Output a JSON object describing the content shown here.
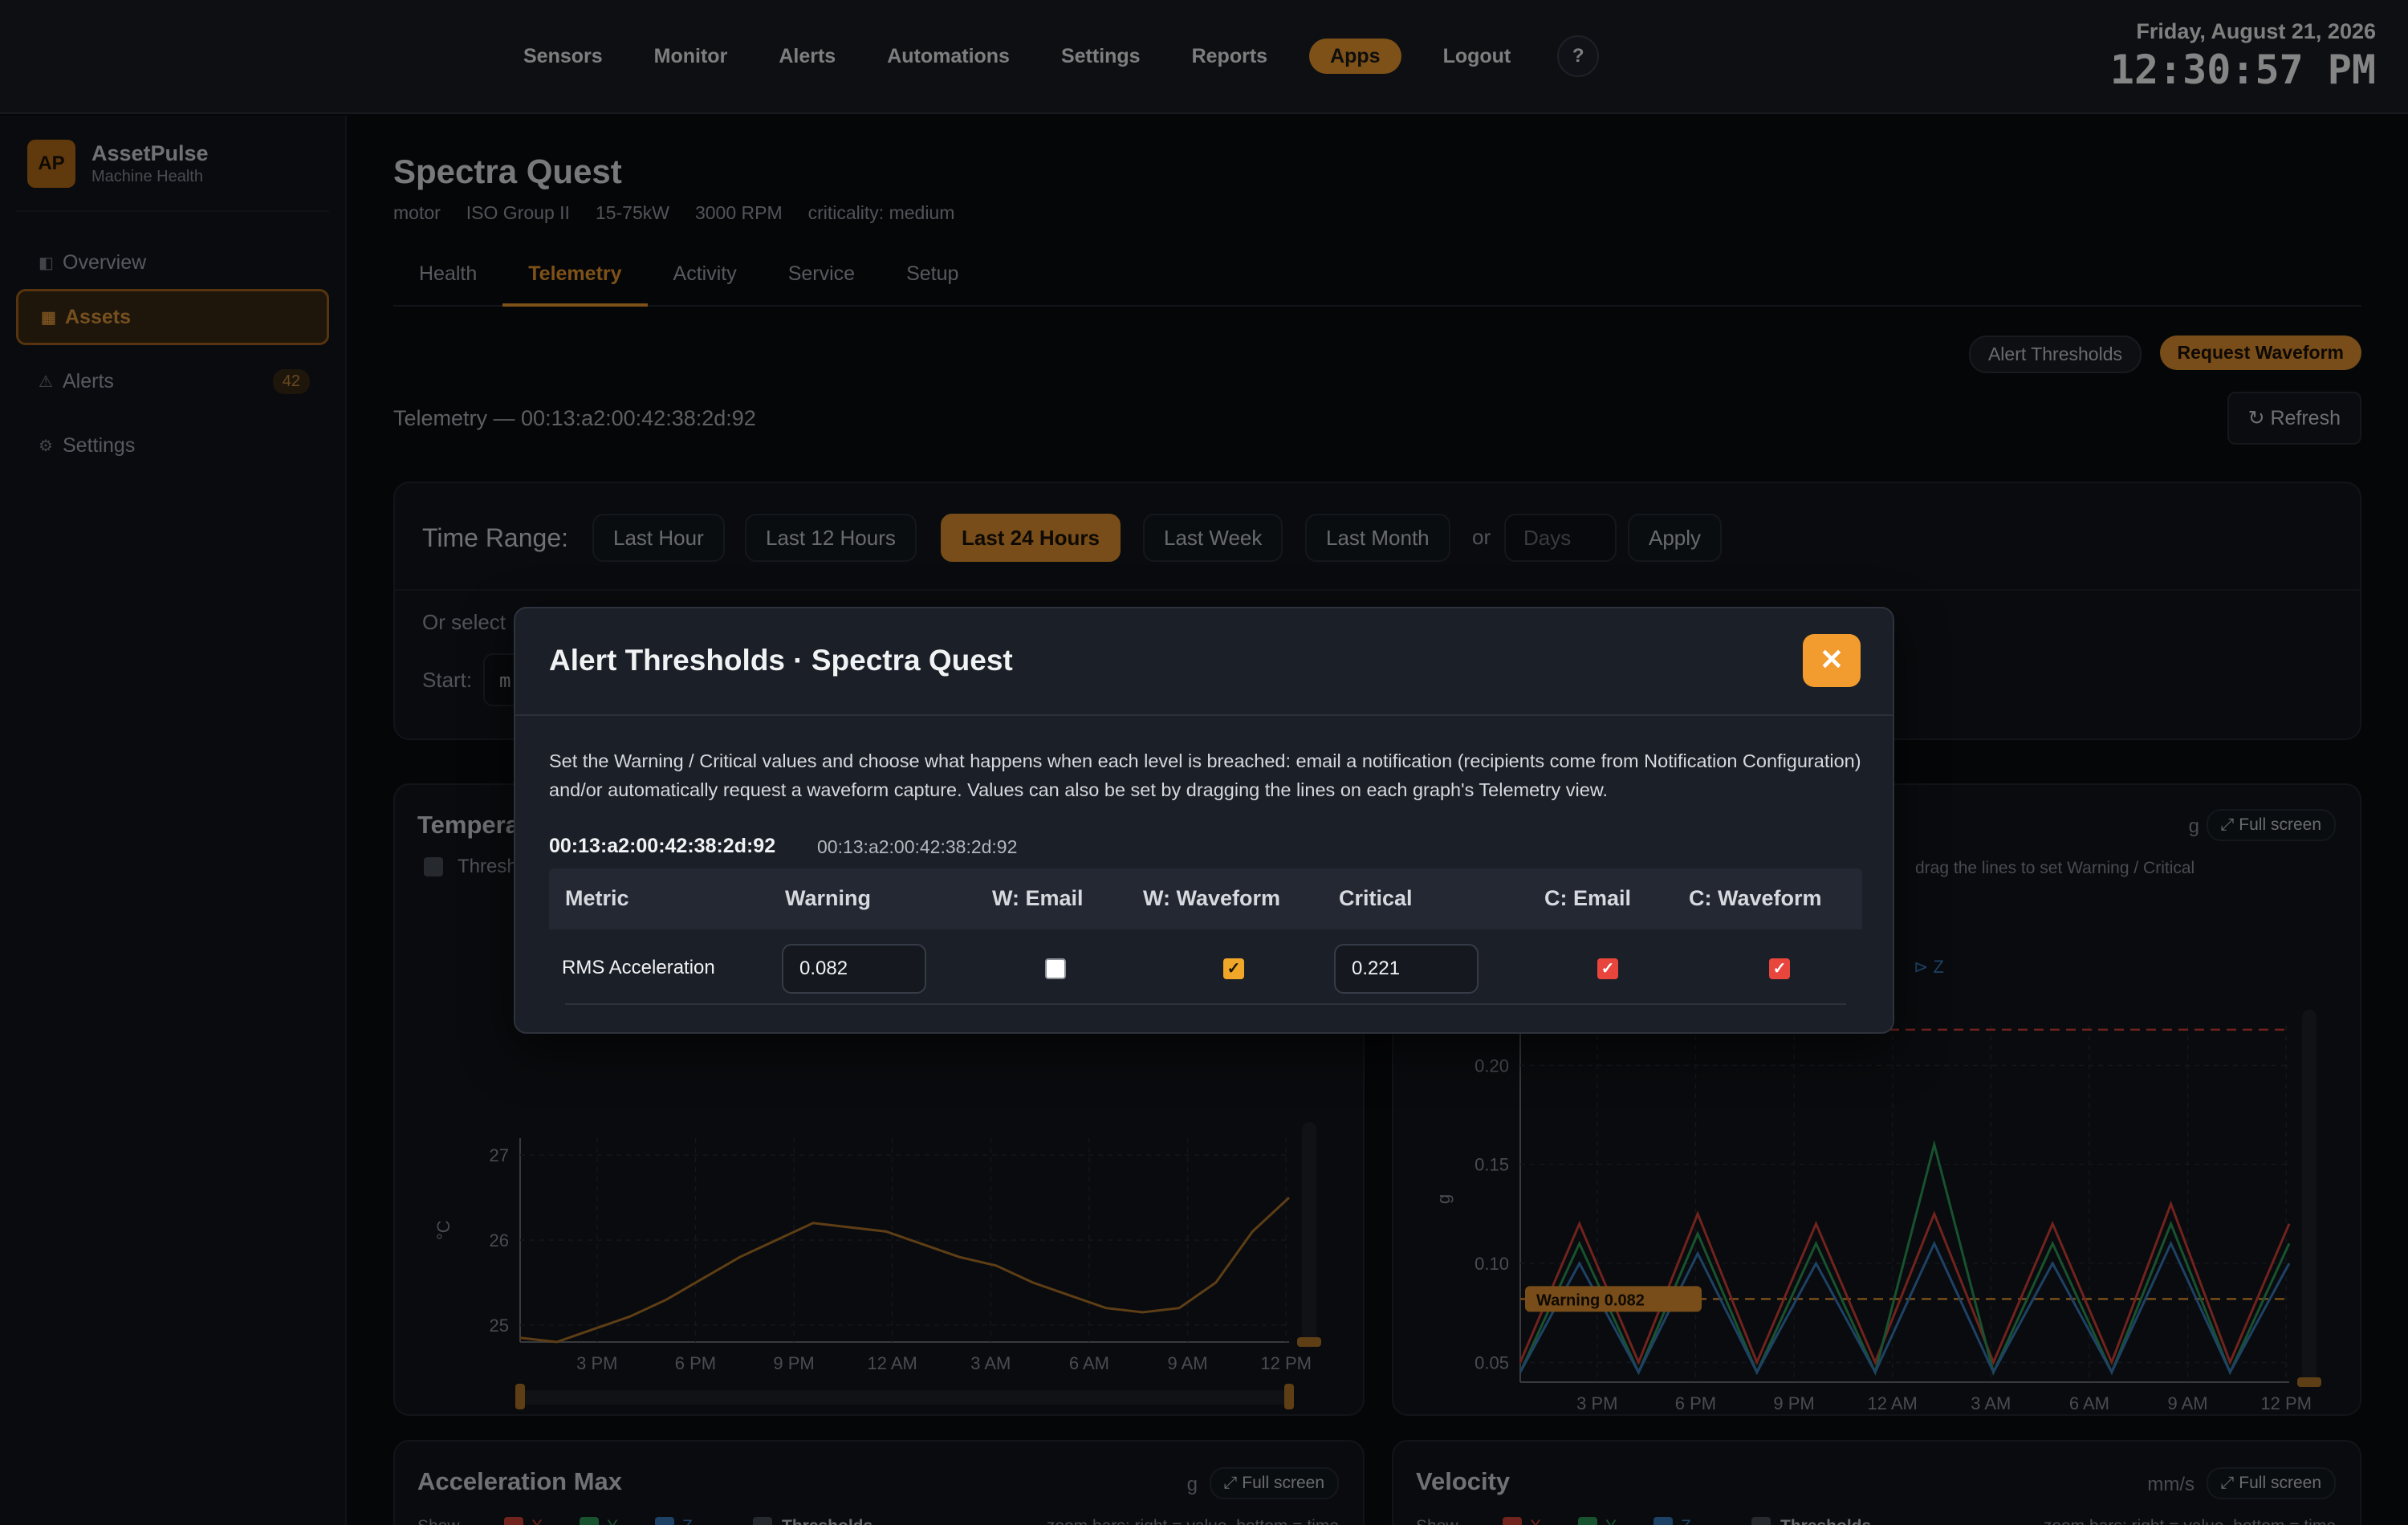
{
  "colors": {
    "accent": "#f29b2e",
    "background": "#0b0d11",
    "critical": "#e8453c",
    "warning": "#f0a628"
  },
  "nav": {
    "items": [
      "Sensors",
      "Monitor",
      "Alerts",
      "Automations",
      "Settings",
      "Reports",
      "Apps",
      "Logout"
    ],
    "active": "Apps",
    "help": "?"
  },
  "clock": {
    "date": "Friday, August 21, 2026",
    "time": "12:30:57 PM"
  },
  "sidebar": {
    "logo": "AP",
    "brand": "AssetPulse",
    "subtitle": "Machine Health",
    "items": [
      {
        "label": "Overview",
        "icon": "overview-icon"
      },
      {
        "label": "Assets",
        "icon": "assets-icon",
        "active": true
      },
      {
        "label": "Alerts",
        "icon": "alert-triangle-icon",
        "badge": "42"
      },
      {
        "label": "Settings",
        "icon": "gear-icon"
      }
    ]
  },
  "asset": {
    "name": "Spectra Quest",
    "meta": [
      "motor",
      "ISO Group II",
      "15-75kW",
      "3000 RPM",
      "criticality: medium"
    ]
  },
  "tabs": [
    "Health",
    "Telemetry",
    "Activity",
    "Service",
    "Setup"
  ],
  "actions": {
    "alert_thresholds": "Alert Thresholds",
    "request_waveform": "Request Waveform",
    "refresh": "↻ Refresh"
  },
  "telemetry_label": "Telemetry — 00:13:a2:00:42:38:2d:92",
  "time_range": {
    "label": "Time Range:",
    "options": [
      "Last Hour",
      "Last 12 Hours",
      "Last 24 Hours",
      "Last Week",
      "Last Month"
    ],
    "active": "Last 24 Hours",
    "or": "or",
    "days_placeholder": "Days",
    "apply": "Apply",
    "or_select": "Or select",
    "start_label": "Start:",
    "start_value": "m"
  },
  "charts": {
    "temperature": {
      "title": "Tempera",
      "threshold_label": "Thresh",
      "unit": "°C"
    },
    "rms": {
      "unit": "g",
      "fullscreen": "⤢ Full screen",
      "hint": "drag the lines to set Warning / Critical",
      "axis_unit": "g",
      "z_label": "Z",
      "warning_tag": "Warning 0.082"
    },
    "accel_max": {
      "title": "Acceleration Max",
      "unit": "g",
      "fullscreen": "⤢ Full screen",
      "show": "Show",
      "x": "X",
      "y": "Y",
      "z": "Z",
      "thresholds": "Thresholds",
      "hint": "zoom bars: right = value, bottom = time"
    },
    "velocity": {
      "title": "Velocity",
      "unit": "mm/s",
      "fullscreen": "⤢ Full screen",
      "show": "Show",
      "x": "X",
      "y": "Y",
      "z": "Z",
      "thresholds": "Thresholds",
      "hint": "zoom bars: right = value, bottom = time"
    }
  },
  "chart_data": [
    {
      "type": "line",
      "title": "",
      "ylabel": "°C",
      "x_ticks": [
        "3 PM",
        "6 PM",
        "9 PM",
        "12 AM",
        "3 AM",
        "6 AM",
        "9 AM",
        "12 PM"
      ],
      "y_ticks": [
        25,
        26,
        27
      ],
      "ylim": [
        24.8,
        27.2
      ],
      "series": [
        {
          "values": [
            24.85,
            24.8,
            24.95,
            25.1,
            25.3,
            25.55,
            25.8,
            26.0,
            26.2,
            26.15,
            26.1,
            25.95,
            25.8,
            25.7,
            25.5,
            25.35,
            25.2,
            25.15,
            25.2,
            25.5,
            26.1,
            26.5
          ]
        }
      ]
    },
    {
      "type": "line",
      "title": "",
      "ylabel": "g",
      "x_ticks": [
        "3 PM",
        "6 PM",
        "9 PM",
        "12 AM",
        "3 AM",
        "6 AM",
        "9 AM",
        "12 PM"
      ],
      "y_ticks": [
        0.05,
        0.1,
        0.15,
        0.2
      ],
      "ylim": [
        0.04,
        0.22
      ],
      "warning": 0.082,
      "critical": 0.221,
      "series": [
        {
          "name": "X",
          "color": "#d9433a",
          "values": [
            0.05,
            0.12,
            0.05,
            0.125,
            0.05,
            0.12,
            0.05,
            0.125,
            0.05,
            0.12,
            0.05,
            0.13,
            0.05,
            0.12
          ]
        },
        {
          "name": "Y",
          "color": "#2e9e5a",
          "values": [
            0.045,
            0.11,
            0.045,
            0.115,
            0.045,
            0.11,
            0.045,
            0.16,
            0.045,
            0.11,
            0.045,
            0.12,
            0.045,
            0.11
          ]
        },
        {
          "name": "Z",
          "color": "#3a7fc1",
          "values": [
            0.045,
            0.1,
            0.045,
            0.105,
            0.045,
            0.1,
            0.045,
            0.11,
            0.045,
            0.1,
            0.045,
            0.11,
            0.045,
            0.1
          ]
        }
      ]
    }
  ],
  "modal": {
    "title": "Alert Thresholds · Spectra Quest",
    "close": "✕",
    "description": "Set the Warning / Critical values and choose what happens when each level is breached: email a notification (recipients come from Notification Configuration) and/or automatically request a waveform capture. Values can also be set by dragging the lines on each graph's Telemetry view.",
    "device_id": "00:13:a2:00:42:38:2d:92",
    "device_id_sub": "00:13:a2:00:42:38:2d:92",
    "headers": [
      "Metric",
      "Warning",
      "W: Email",
      "W: Waveform",
      "Critical",
      "C: Email",
      "C: Waveform"
    ],
    "rows": [
      {
        "metric": "RMS Acceleration",
        "warning": "0.082",
        "w_email": false,
        "w_waveform": true,
        "critical": "0.221",
        "c_email": true,
        "c_waveform": true
      }
    ]
  }
}
